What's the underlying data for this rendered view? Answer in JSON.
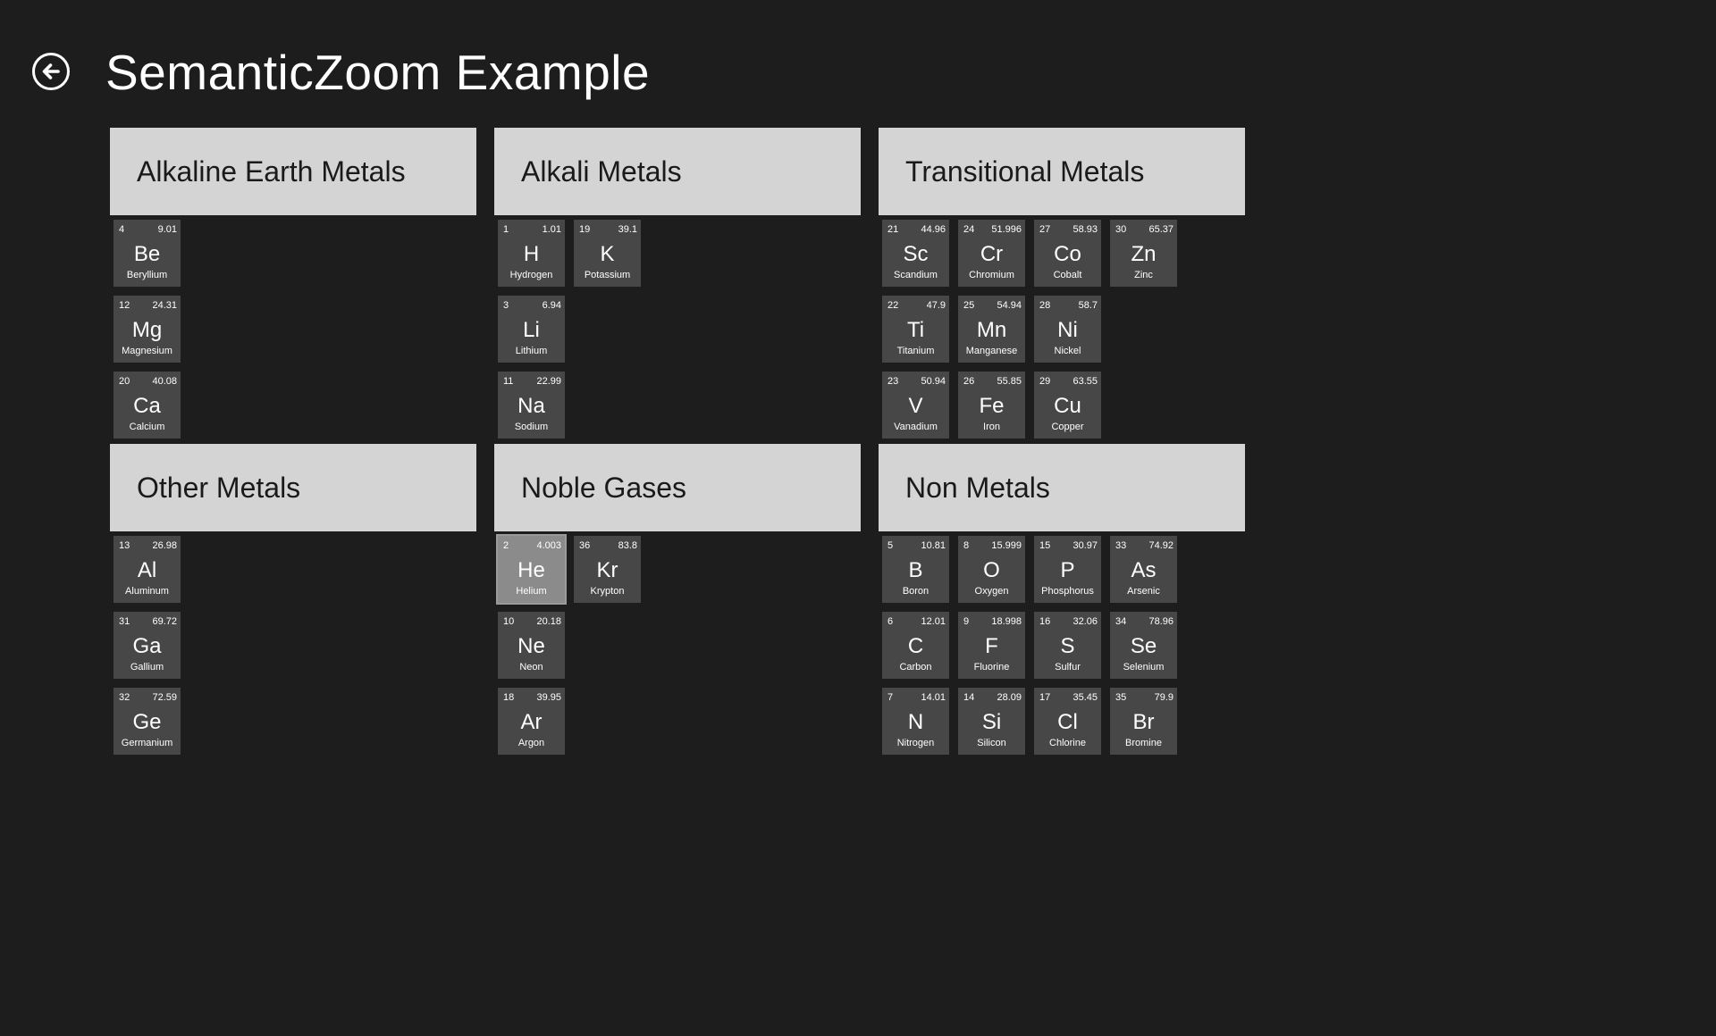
{
  "header": {
    "title": "SemanticZoom Example",
    "back_icon": "arrow-left-circle-icon"
  },
  "colors": {
    "background": "#1d1d1d",
    "group_header": "#d4d4d4",
    "tile": "#474747",
    "tile_selected": "#8b8b8b"
  },
  "groups": [
    {
      "title": "Alkaline Earth Metals",
      "elements": [
        {
          "number": "4",
          "mass": "9.01",
          "symbol": "Be",
          "name": "Beryllium"
        },
        {
          "number": "12",
          "mass": "24.31",
          "symbol": "Mg",
          "name": "Magnesium"
        },
        {
          "number": "20",
          "mass": "40.08",
          "symbol": "Ca",
          "name": "Calcium"
        }
      ]
    },
    {
      "title": "Alkali Metals",
      "elements": [
        {
          "number": "1",
          "mass": "1.01",
          "symbol": "H",
          "name": "Hydrogen"
        },
        {
          "number": "3",
          "mass": "6.94",
          "symbol": "Li",
          "name": "Lithium"
        },
        {
          "number": "11",
          "mass": "22.99",
          "symbol": "Na",
          "name": "Sodium"
        },
        {
          "number": "19",
          "mass": "39.1",
          "symbol": "K",
          "name": "Potassium"
        }
      ]
    },
    {
      "title": "Transitional Metals",
      "elements": [
        {
          "number": "21",
          "mass": "44.96",
          "symbol": "Sc",
          "name": "Scandium"
        },
        {
          "number": "22",
          "mass": "47.9",
          "symbol": "Ti",
          "name": "Titanium"
        },
        {
          "number": "23",
          "mass": "50.94",
          "symbol": "V",
          "name": "Vanadium"
        },
        {
          "number": "24",
          "mass": "51.996",
          "symbol": "Cr",
          "name": "Chromium"
        },
        {
          "number": "25",
          "mass": "54.94",
          "symbol": "Mn",
          "name": "Manganese"
        },
        {
          "number": "26",
          "mass": "55.85",
          "symbol": "Fe",
          "name": "Iron"
        },
        {
          "number": "27",
          "mass": "58.93",
          "symbol": "Co",
          "name": "Cobalt"
        },
        {
          "number": "28",
          "mass": "58.7",
          "symbol": "Ni",
          "name": "Nickel"
        },
        {
          "number": "29",
          "mass": "63.55",
          "symbol": "Cu",
          "name": "Copper"
        },
        {
          "number": "30",
          "mass": "65.37",
          "symbol": "Zn",
          "name": "Zinc"
        }
      ]
    },
    {
      "title": "Other Metals",
      "elements": [
        {
          "number": "13",
          "mass": "26.98",
          "symbol": "Al",
          "name": "Aluminum"
        },
        {
          "number": "31",
          "mass": "69.72",
          "symbol": "Ga",
          "name": "Gallium"
        },
        {
          "number": "32",
          "mass": "72.59",
          "symbol": "Ge",
          "name": "Germanium"
        }
      ]
    },
    {
      "title": "Noble Gases",
      "elements": [
        {
          "number": "2",
          "mass": "4.003",
          "symbol": "He",
          "name": "Helium",
          "selected": true
        },
        {
          "number": "10",
          "mass": "20.18",
          "symbol": "Ne",
          "name": "Neon"
        },
        {
          "number": "18",
          "mass": "39.95",
          "symbol": "Ar",
          "name": "Argon"
        },
        {
          "number": "36",
          "mass": "83.8",
          "symbol": "Kr",
          "name": "Krypton"
        }
      ]
    },
    {
      "title": "Non Metals",
      "elements": [
        {
          "number": "5",
          "mass": "10.81",
          "symbol": "B",
          "name": "Boron"
        },
        {
          "number": "6",
          "mass": "12.01",
          "symbol": "C",
          "name": "Carbon"
        },
        {
          "number": "7",
          "mass": "14.01",
          "symbol": "N",
          "name": "Nitrogen"
        },
        {
          "number": "8",
          "mass": "15.999",
          "symbol": "O",
          "name": "Oxygen"
        },
        {
          "number": "9",
          "mass": "18.998",
          "symbol": "F",
          "name": "Fluorine"
        },
        {
          "number": "14",
          "mass": "28.09",
          "symbol": "Si",
          "name": "Silicon"
        },
        {
          "number": "15",
          "mass": "30.97",
          "symbol": "P",
          "name": "Phosphorus"
        },
        {
          "number": "16",
          "mass": "32.06",
          "symbol": "S",
          "name": "Sulfur"
        },
        {
          "number": "17",
          "mass": "35.45",
          "symbol": "Cl",
          "name": "Chlorine"
        },
        {
          "number": "33",
          "mass": "74.92",
          "symbol": "As",
          "name": "Arsenic"
        },
        {
          "number": "34",
          "mass": "78.96",
          "symbol": "Se",
          "name": "Selenium"
        },
        {
          "number": "35",
          "mass": "79.9",
          "symbol": "Br",
          "name": "Bromine"
        }
      ]
    }
  ]
}
